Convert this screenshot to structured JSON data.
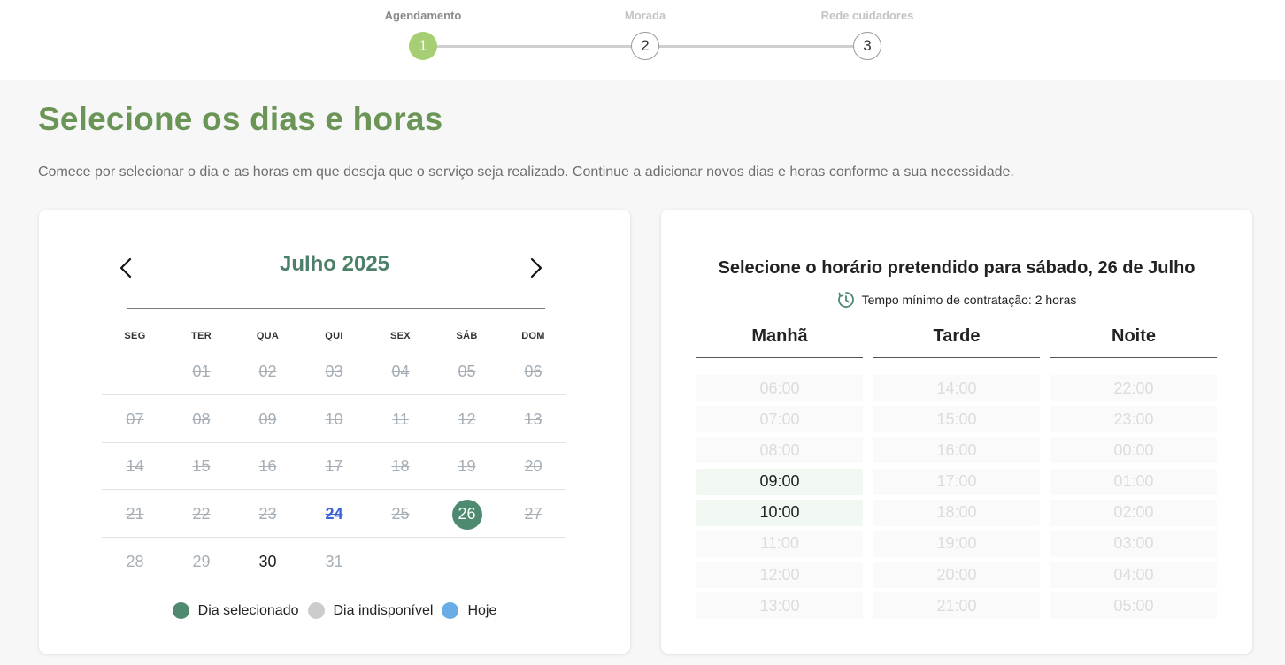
{
  "stepper": {
    "steps": [
      {
        "number": "1",
        "label": "Agendamento",
        "state": "active"
      },
      {
        "number": "2",
        "label": "Morada",
        "state": "inactive"
      },
      {
        "number": "3",
        "label": "Rede cuidadores",
        "state": "inactive"
      }
    ]
  },
  "page": {
    "title": "Selecione os dias e horas",
    "description": "Comece por selecionar o dia e as horas em que deseja que o serviço seja realizado. Continue a adicionar novos dias e horas conforme a sua necessidade."
  },
  "calendar": {
    "month_label": "Julho 2025",
    "prev_icon": "chevron-left-icon",
    "next_icon": "chevron-right-icon",
    "weekdays": [
      "SEG",
      "TER",
      "QUA",
      "QUI",
      "SEX",
      "SÁB",
      "DOM"
    ],
    "weeks": [
      [
        {
          "d": "",
          "s": "empty"
        },
        {
          "d": "01",
          "s": "disabled"
        },
        {
          "d": "02",
          "s": "disabled"
        },
        {
          "d": "03",
          "s": "disabled"
        },
        {
          "d": "04",
          "s": "disabled"
        },
        {
          "d": "05",
          "s": "disabled"
        },
        {
          "d": "06",
          "s": "disabled"
        }
      ],
      [
        {
          "d": "07",
          "s": "disabled"
        },
        {
          "d": "08",
          "s": "disabled"
        },
        {
          "d": "09",
          "s": "disabled"
        },
        {
          "d": "10",
          "s": "disabled"
        },
        {
          "d": "11",
          "s": "disabled"
        },
        {
          "d": "12",
          "s": "disabled"
        },
        {
          "d": "13",
          "s": "disabled"
        }
      ],
      [
        {
          "d": "14",
          "s": "disabled"
        },
        {
          "d": "15",
          "s": "disabled"
        },
        {
          "d": "16",
          "s": "disabled"
        },
        {
          "d": "17",
          "s": "disabled"
        },
        {
          "d": "18",
          "s": "disabled"
        },
        {
          "d": "19",
          "s": "disabled"
        },
        {
          "d": "20",
          "s": "disabled"
        }
      ],
      [
        {
          "d": "21",
          "s": "disabled"
        },
        {
          "d": "22",
          "s": "disabled"
        },
        {
          "d": "23",
          "s": "disabled"
        },
        {
          "d": "24",
          "s": "today"
        },
        {
          "d": "25",
          "s": "disabled"
        },
        {
          "d": "26",
          "s": "selected"
        },
        {
          "d": "27",
          "s": "disabled"
        }
      ],
      [
        {
          "d": "28",
          "s": "disabled"
        },
        {
          "d": "29",
          "s": "disabled"
        },
        {
          "d": "30",
          "s": "available"
        },
        {
          "d": "31",
          "s": "disabled"
        },
        {
          "d": "",
          "s": "empty"
        },
        {
          "d": "",
          "s": "empty"
        },
        {
          "d": "",
          "s": "empty"
        }
      ]
    ],
    "legend": [
      {
        "label": "Dia selecionado",
        "color": "#4e8a70"
      },
      {
        "label": "Dia indisponível",
        "color": "#cccccc"
      },
      {
        "label": "Hoje",
        "color": "#6aade6"
      }
    ]
  },
  "schedule": {
    "title": "Selecione o horário pretendido para sábado, 26 de Julho",
    "min_time_icon": "clock-icon",
    "min_time": "Tempo mínimo de contratação: 2 horas",
    "columns": [
      {
        "name": "Manhã",
        "slots": [
          {
            "t": "06:00",
            "s": "disabled"
          },
          {
            "t": "07:00",
            "s": "disabled"
          },
          {
            "t": "08:00",
            "s": "disabled"
          },
          {
            "t": "09:00",
            "s": "selected"
          },
          {
            "t": "10:00",
            "s": "selected"
          },
          {
            "t": "11:00",
            "s": "disabled"
          },
          {
            "t": "12:00",
            "s": "disabled"
          },
          {
            "t": "13:00",
            "s": "disabled"
          }
        ]
      },
      {
        "name": "Tarde",
        "slots": [
          {
            "t": "14:00",
            "s": "disabled"
          },
          {
            "t": "15:00",
            "s": "disabled"
          },
          {
            "t": "16:00",
            "s": "disabled"
          },
          {
            "t": "17:00",
            "s": "disabled"
          },
          {
            "t": "18:00",
            "s": "disabled"
          },
          {
            "t": "19:00",
            "s": "disabled"
          },
          {
            "t": "20:00",
            "s": "disabled"
          },
          {
            "t": "21:00",
            "s": "disabled"
          }
        ]
      },
      {
        "name": "Noite",
        "slots": [
          {
            "t": "22:00",
            "s": "disabled"
          },
          {
            "t": "23:00",
            "s": "disabled"
          },
          {
            "t": "00:00",
            "s": "disabled"
          },
          {
            "t": "01:00",
            "s": "disabled"
          },
          {
            "t": "02:00",
            "s": "disabled"
          },
          {
            "t": "03:00",
            "s": "disabled"
          },
          {
            "t": "04:00",
            "s": "disabled"
          },
          {
            "t": "05:00",
            "s": "disabled"
          }
        ]
      }
    ]
  },
  "colors": {
    "accent_green": "#6a9557",
    "selected_day": "#4e8a70",
    "step_active": "#a6cf73",
    "today_blue": "#3d62d8"
  }
}
